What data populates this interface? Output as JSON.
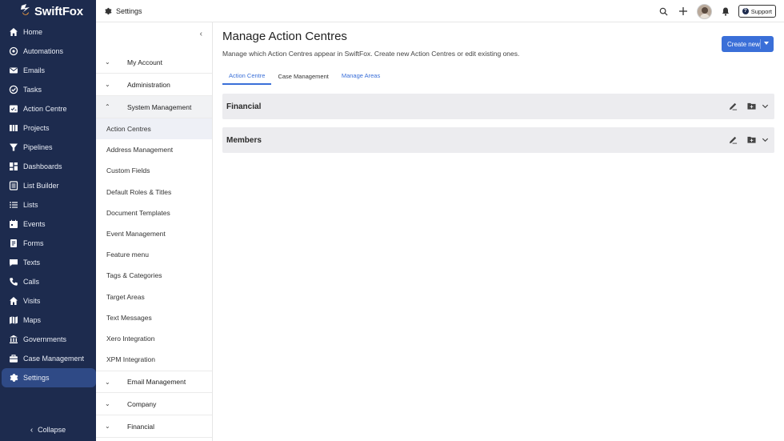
{
  "brand": {
    "name": "SwiftFox"
  },
  "nav": {
    "items": [
      {
        "label": "Home",
        "icon": "home-icon"
      },
      {
        "label": "Automations",
        "icon": "automations-icon"
      },
      {
        "label": "Emails",
        "icon": "email-icon"
      },
      {
        "label": "Tasks",
        "icon": "tasks-icon"
      },
      {
        "label": "Action Centre",
        "icon": "action-centre-icon"
      },
      {
        "label": "Projects",
        "icon": "projects-icon"
      },
      {
        "label": "Pipelines",
        "icon": "pipelines-icon"
      },
      {
        "label": "Dashboards",
        "icon": "dashboards-icon"
      },
      {
        "label": "List Builder",
        "icon": "list-builder-icon"
      },
      {
        "label": "Lists",
        "icon": "lists-icon"
      },
      {
        "label": "Events",
        "icon": "events-icon"
      },
      {
        "label": "Forms",
        "icon": "forms-icon"
      },
      {
        "label": "Texts",
        "icon": "texts-icon"
      },
      {
        "label": "Calls",
        "icon": "calls-icon"
      },
      {
        "label": "Visits",
        "icon": "visits-icon"
      },
      {
        "label": "Maps",
        "icon": "maps-icon"
      },
      {
        "label": "Governments",
        "icon": "governments-icon"
      },
      {
        "label": "Case Management",
        "icon": "case-management-icon"
      },
      {
        "label": "Settings",
        "icon": "settings-icon",
        "active": true
      }
    ],
    "collapse_label": "Collapse"
  },
  "topbar": {
    "title": "Settings",
    "support_label": "Support"
  },
  "settings_menu": {
    "sections_top": [
      {
        "label": "My Account"
      },
      {
        "label": "Administration"
      },
      {
        "label": "System Management",
        "expanded": true
      }
    ],
    "sub_items": [
      {
        "label": "Action Centres",
        "active": true
      },
      {
        "label": "Address Management"
      },
      {
        "label": "Custom Fields"
      },
      {
        "label": "Default Roles & Titles"
      },
      {
        "label": "Document Templates"
      },
      {
        "label": "Event Management"
      },
      {
        "label": "Feature menu"
      },
      {
        "label": "Tags & Categories"
      },
      {
        "label": "Target Areas"
      },
      {
        "label": "Text Messages"
      },
      {
        "label": "Xero Integration"
      },
      {
        "label": "XPM Integration"
      }
    ],
    "sections_bottom": [
      {
        "label": "Email Management"
      },
      {
        "label": "Company"
      },
      {
        "label": "Financial"
      }
    ]
  },
  "main": {
    "title": "Manage Action Centres",
    "description": "Manage which Action Centres appear in SwiftFox. Create new Action Centres or edit existing ones.",
    "create_button": "Create new",
    "tabs": [
      {
        "label": "Action Centre",
        "active": true
      },
      {
        "label": "Case Management"
      },
      {
        "label": "Manage Areas",
        "link": true
      }
    ],
    "cards": [
      {
        "title": "Financial"
      },
      {
        "title": "Members"
      }
    ]
  },
  "colors": {
    "nav_bg": "#1d2b4e",
    "nav_active": "#2f4a86",
    "accent": "#3a6fd8",
    "card_bg": "#ececef"
  }
}
